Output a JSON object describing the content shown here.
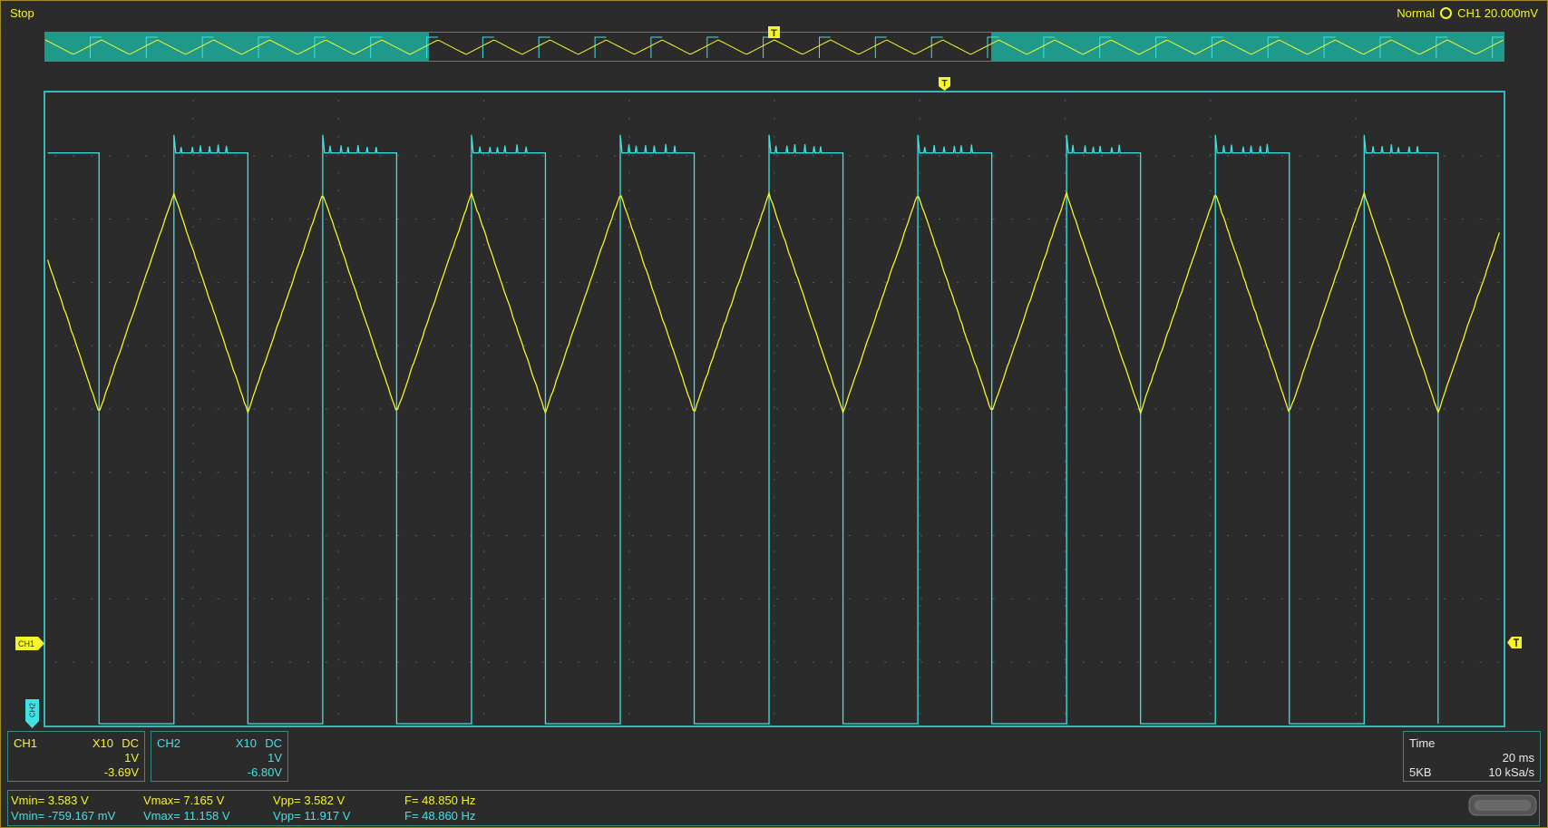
{
  "header": {
    "status": "Stop",
    "trigger_mode": "Normal",
    "trigger_source_level": "CH1 20.000mV"
  },
  "markers": {
    "trigger_label": "T",
    "ch1_marker": "CH1",
    "ch2_marker": "CH2"
  },
  "ch1_box": {
    "name": "CH1",
    "probe": "X10",
    "coupling": "DC",
    "scale": "1V",
    "offset": "-3.69V"
  },
  "ch2_box": {
    "name": "CH2",
    "probe": "X10",
    "coupling": "DC",
    "scale": "1V",
    "offset": "-6.80V"
  },
  "time_box": {
    "title": "Time",
    "timebase": "20 ms",
    "memory": "5KB",
    "sample_rate": "10 kSa/s"
  },
  "measurements": {
    "ch1": {
      "vmin": "Vmin= 3.583 V",
      "vmax": "Vmax= 7.165 V",
      "vpp": "Vpp= 3.582 V",
      "freq": "F= 48.850 Hz"
    },
    "ch2": {
      "vmin": "Vmin= -759.167 mV",
      "vmax": "Vmax= 11.158 V",
      "vpp": "Vpp= 11.917 V",
      "freq": "F= 48.860 Hz"
    }
  },
  "colors": {
    "ch1": "#f5f52a",
    "ch2": "#3fe3e3",
    "grid": "#4a6a6a",
    "frame": "#38b8b8"
  },
  "chart_data": {
    "type": "line",
    "grid_divisions": {
      "x": 10,
      "y": 10
    },
    "series": [
      {
        "name": "CH1",
        "shape": "triangle",
        "freq_hz": 48.85,
        "vmin": 3.583,
        "vmax": 7.165
      },
      {
        "name": "CH2",
        "shape": "square",
        "freq_hz": 48.86,
        "vmin": -0.759,
        "vmax": 11.158
      }
    ]
  }
}
